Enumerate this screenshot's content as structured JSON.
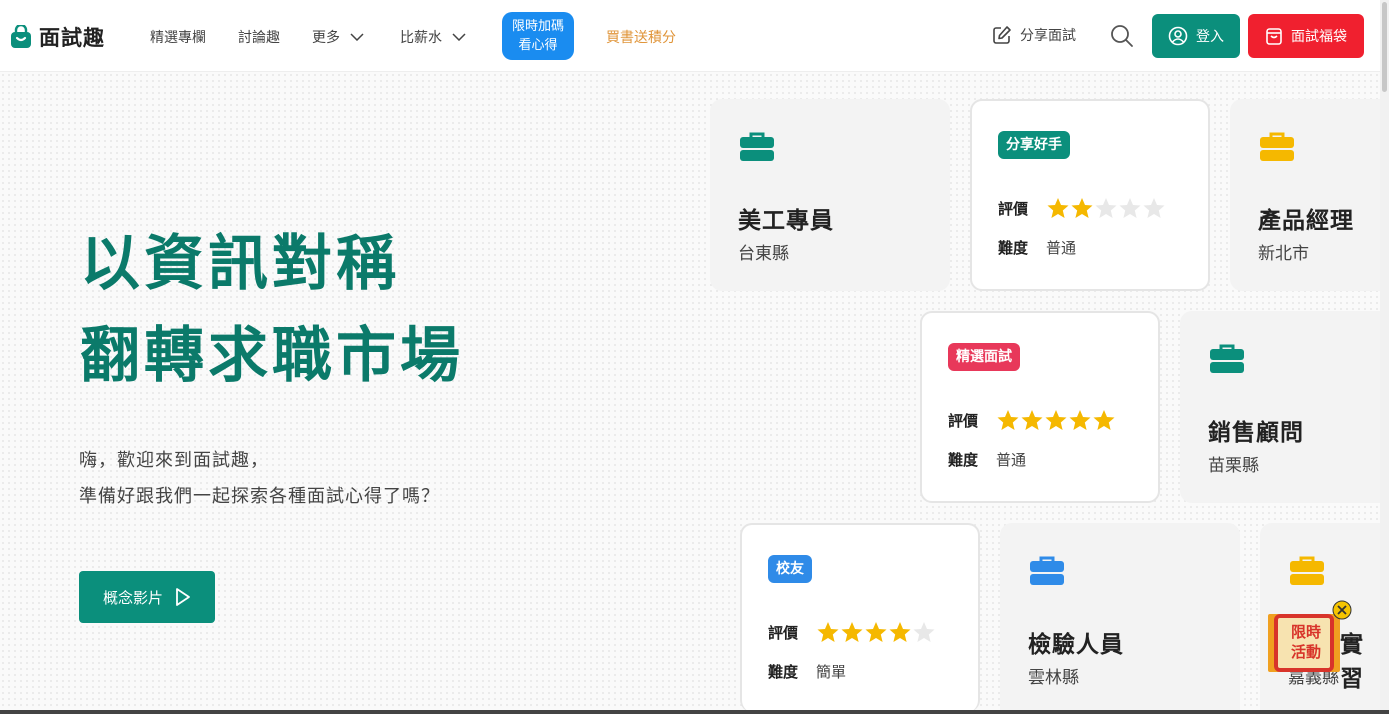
{
  "header": {
    "logo_text": "面試趣",
    "nav": [
      {
        "label": "精選專欄"
      },
      {
        "label": "討論趣"
      },
      {
        "label": "更多"
      },
      {
        "label": "比薪水"
      }
    ],
    "promo_line1": "限時加碼",
    "promo_line2": "看心得",
    "book_link": "買書送積分",
    "share_label": "分享面試",
    "login_label": "登入",
    "bag_label": "面試福袋"
  },
  "hero": {
    "line1": "以資訊對稱",
    "line2": "翻轉求職市場",
    "sub1": "嗨，歡迎來到面試趣，",
    "sub2": "準備好跟我們一起探索各種面試心得了嗎？",
    "video_label": "概念影片"
  },
  "labels": {
    "rating": "評價",
    "difficulty": "難度"
  },
  "cards": {
    "c1": {
      "title": "美工專員",
      "location": "台東縣",
      "icon_color": "#0b8f7c"
    },
    "c2": {
      "badge": "分享好手",
      "badge_color": "#0b8f7c",
      "rating": 2,
      "difficulty": "普通"
    },
    "c3": {
      "title": "產品經理",
      "location": "新北市",
      "icon_color": "#f5b800"
    },
    "c4": {
      "badge": "精選面試",
      "badge_color": "#e8385a",
      "rating": 5,
      "difficulty": "普通"
    },
    "c5": {
      "title": "銷售顧問",
      "location": "苗栗縣",
      "icon_color": "#0b8f7c"
    },
    "c6": {
      "badge": "校友",
      "badge_color": "#2f8be8",
      "rating": 4,
      "difficulty": "簡單"
    },
    "c7": {
      "title": "檢驗人員",
      "location": "雲林縣",
      "icon_color": "#2f8be8"
    },
    "c8": {
      "title": "實習",
      "location": "嘉義縣",
      "icon_color": "#f5b800"
    }
  },
  "float_promo": {
    "line1": "限時",
    "line2": "活動"
  },
  "colors": {
    "brand": "#0b8f7c",
    "accent_red": "#f0202f",
    "promo_blue": "#1a8cf0",
    "star": "#f5b800"
  }
}
